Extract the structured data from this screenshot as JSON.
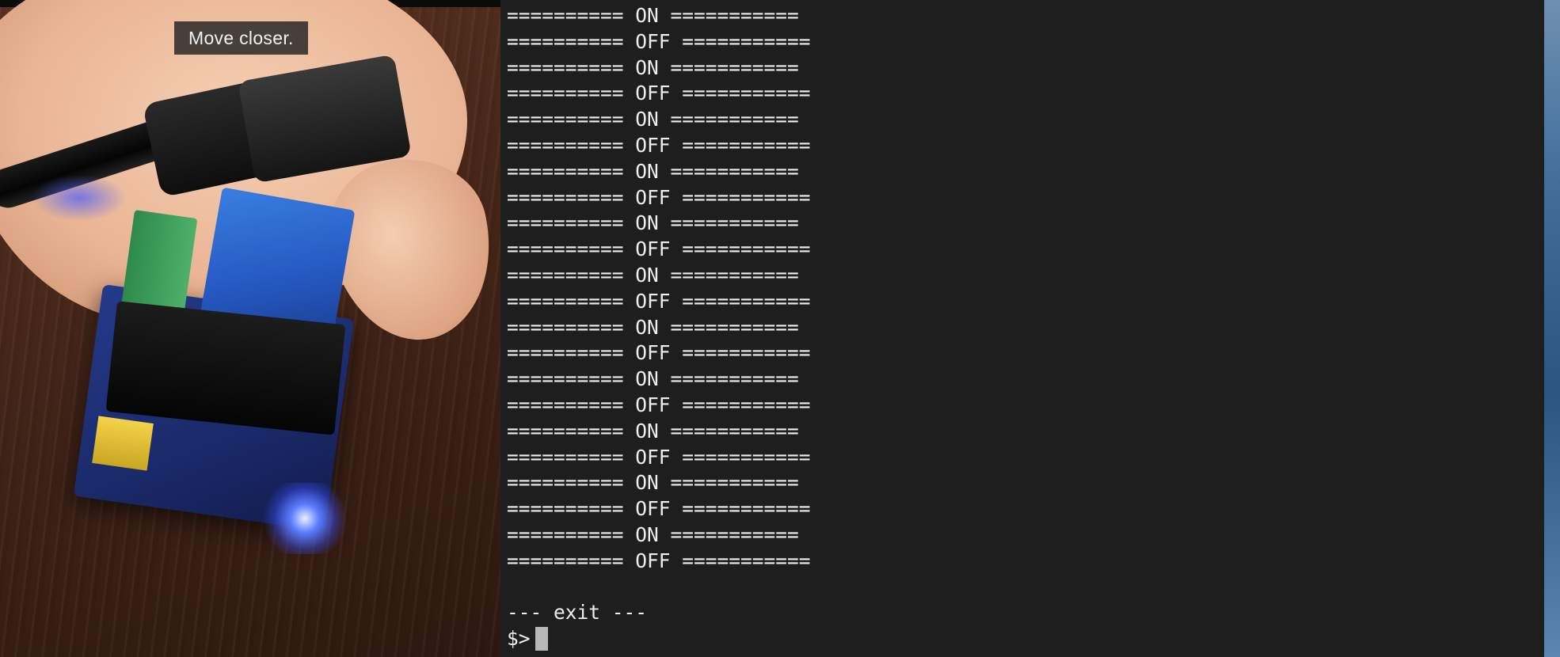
{
  "camera": {
    "caption": "Move closer."
  },
  "terminal": {
    "lines": [
      "========== ON ===========",
      "========== OFF ===========",
      "========== ON ===========",
      "========== OFF ===========",
      "========== ON ===========",
      "========== OFF ===========",
      "========== ON ===========",
      "========== OFF ===========",
      "========== ON ===========",
      "========== OFF ===========",
      "========== ON ===========",
      "========== OFF ===========",
      "========== ON ===========",
      "========== OFF ===========",
      "========== ON ===========",
      "========== OFF ===========",
      "========== ON ===========",
      "========== OFF ===========",
      "========== ON ===========",
      "========== OFF ===========",
      "========== ON ===========",
      "========== OFF ===========",
      "",
      "--- exit ---"
    ],
    "prompt": "$>"
  },
  "colors": {
    "terminal_bg": "#1e1e1e",
    "terminal_text": "#eeeeee",
    "cursor": "#b8b8b8",
    "caption_bg": "#282828"
  }
}
